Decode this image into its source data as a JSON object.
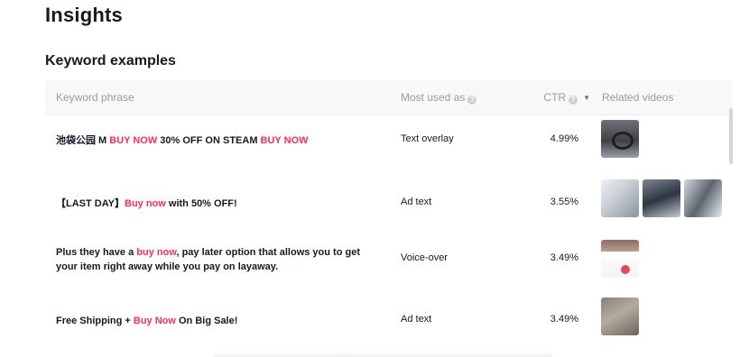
{
  "page": {
    "title": "Insights"
  },
  "section": {
    "title": "Keyword examples"
  },
  "table": {
    "headers": {
      "phrase": "Keyword phrase",
      "most_used_as": "Most used as",
      "ctr": "CTR",
      "related_videos": "Related videos"
    },
    "rows": [
      {
        "phrase_parts": [
          {
            "text": "池袋公园 M ",
            "hl": false
          },
          {
            "text": "BUY NOW",
            "hl": true
          },
          {
            "text": " 30% OFF ON STEAM ",
            "hl": false
          },
          {
            "text": "BUY NOW",
            "hl": true
          }
        ],
        "most_used_as": "Text overlay",
        "ctr": "4.99%",
        "videos": [
          "video-thumbnail"
        ]
      },
      {
        "phrase_parts": [
          {
            "text": "【LAST DAY】",
            "hl": false
          },
          {
            "text": "Buy now",
            "hl": true
          },
          {
            "text": " with 50% OFF!",
            "hl": false
          }
        ],
        "most_used_as": "Ad text",
        "ctr": "3.55%",
        "videos": [
          "video-thumbnail",
          "video-thumbnail",
          "video-thumbnail"
        ]
      },
      {
        "phrase_parts": [
          {
            "text": "Plus they have a ",
            "hl": false
          },
          {
            "text": "buy now",
            "hl": true
          },
          {
            "text": ", pay later option that allows you to get your item right away while you pay on layaway.",
            "hl": false
          }
        ],
        "most_used_as": "Voice-over",
        "ctr": "3.49%",
        "videos": [
          "video-thumbnail"
        ]
      },
      {
        "phrase_parts": [
          {
            "text": "Free Shipping + ",
            "hl": false
          },
          {
            "text": "Buy Now",
            "hl": true
          },
          {
            "text": " On Big Sale!",
            "hl": false
          }
        ],
        "most_used_as": "Ad text",
        "ctr": "3.49%",
        "videos": [
          "video-thumbnail"
        ]
      }
    ]
  },
  "colors": {
    "highlight": "#fe2c55",
    "text": "#161823",
    "header_bg": "#f8f8f8"
  }
}
